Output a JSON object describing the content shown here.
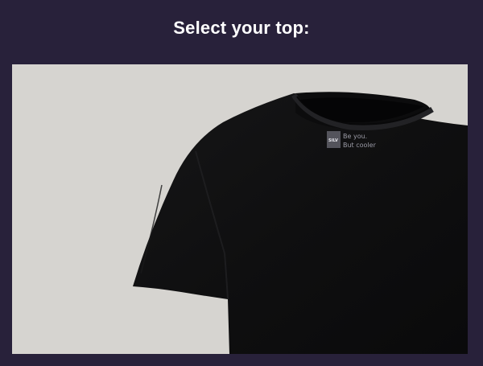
{
  "header": {
    "title": "Select your top:"
  },
  "product": {
    "icon": "tshirt-image",
    "colors": {
      "background": "#28213a",
      "card": "#d6d4d0",
      "shirt": "#0f0f10"
    },
    "tag": {
      "brand": "SILV",
      "line1": "Be you.",
      "line2": "But cooler"
    }
  }
}
